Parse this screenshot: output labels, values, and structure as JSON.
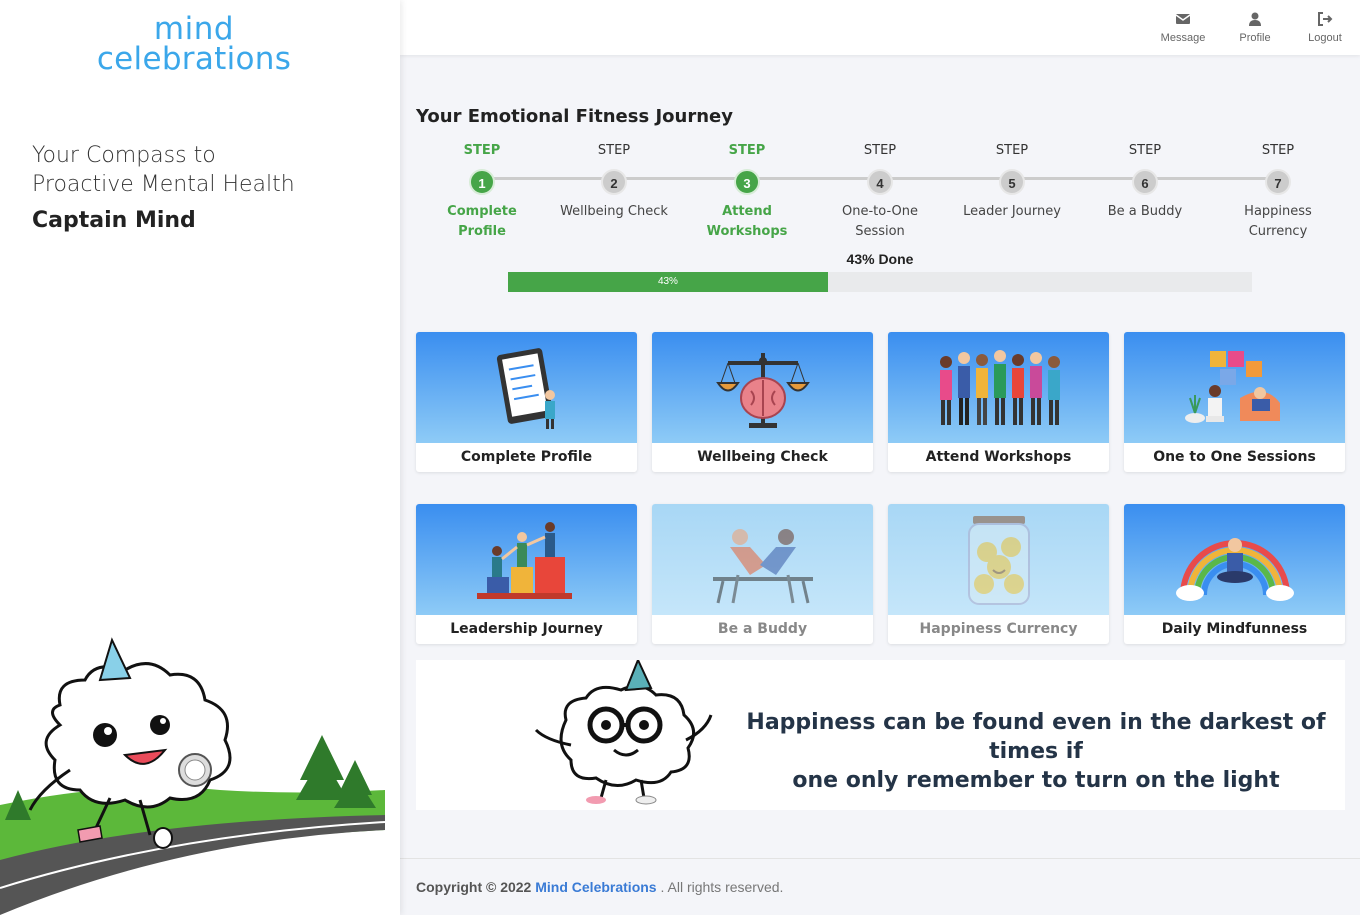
{
  "brand": {
    "line1": "mind",
    "line2": "celebrations",
    "color": "#3ba7ea"
  },
  "sidebar": {
    "tagline_line1": "Your Compass to",
    "tagline_line2": "Proactive Mental Health",
    "user_name": "Captain Mind"
  },
  "topnav": [
    {
      "label": "Message",
      "icon": "envelope-icon"
    },
    {
      "label": "Profile",
      "icon": "user-icon"
    },
    {
      "label": "Logout",
      "icon": "sign-out-icon"
    }
  ],
  "journey": {
    "title": "Your Emotional Fitness Journey",
    "steps": [
      {
        "step_label": "STEP",
        "number": "1",
        "line1": "Complete",
        "line2": "Profile",
        "done": true
      },
      {
        "step_label": "STEP",
        "number": "2",
        "line1": "Wellbeing Check",
        "line2": "",
        "done": false
      },
      {
        "step_label": "STEP",
        "number": "3",
        "line1": "Attend",
        "line2": "Workshops",
        "done": true
      },
      {
        "step_label": "STEP",
        "number": "4",
        "line1": "One-to-One",
        "line2": "Session",
        "done": false
      },
      {
        "step_label": "STEP",
        "number": "5",
        "line1": "Leader Journey",
        "line2": "",
        "done": false
      },
      {
        "step_label": "STEP",
        "number": "6",
        "line1": "Be a Buddy",
        "line2": "",
        "done": false
      },
      {
        "step_label": "STEP",
        "number": "7",
        "line1": "Happiness",
        "line2": "Currency",
        "done": false
      }
    ],
    "progress_text": "43% Done",
    "progress_bar_label": "43%",
    "progress_value": 43,
    "done_color": "#46a548"
  },
  "cards": [
    {
      "title": "Complete Profile",
      "icon": "tablet-document-icon",
      "faded": false
    },
    {
      "title": "Wellbeing Check",
      "icon": "brain-scale-icon",
      "faded": false
    },
    {
      "title": "Attend Workshops",
      "icon": "group-people-icon",
      "faded": false
    },
    {
      "title": "One to One Sessions",
      "icon": "puzzle-therapy-icon",
      "faded": false
    },
    {
      "title": "Leadership Journey",
      "icon": "teamwork-steps-icon",
      "faded": false
    },
    {
      "title": "Be a Buddy",
      "icon": "handshake-icon",
      "faded": true
    },
    {
      "title": "Happiness Currency",
      "icon": "smiley-jar-icon",
      "faded": true
    },
    {
      "title": "Daily Mindfunness",
      "icon": "rainbow-meditation-icon",
      "faded": false
    }
  ],
  "quote": {
    "line1": "Happiness can be found even in the darkest of times if",
    "line2": "one only remember to turn on the light"
  },
  "footer": {
    "prefix": "Copyright © 2022",
    "company": "Mind Celebrations",
    "suffix": ". All rights reserved."
  }
}
